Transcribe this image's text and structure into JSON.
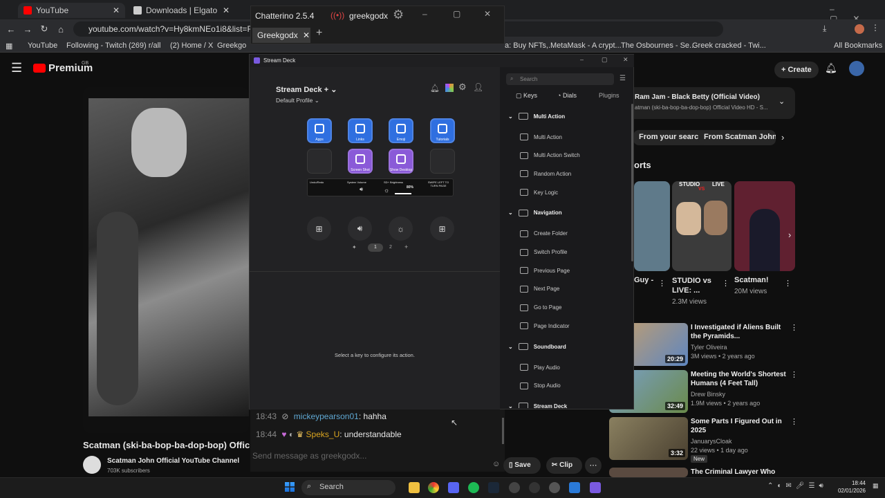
{
  "browser": {
    "tabs": [
      {
        "label": "YouTube",
        "color": "#ff0000"
      },
      {
        "label": "Downloads | Elgato",
        "color": "#cccccc"
      }
    ],
    "url": "youtube.com/watch?v=Hy8kmNEo1i8&list=RDHy8kmNE",
    "bookmarks": [
      "YouTube",
      "Following - Twitch",
      "(269) r/all",
      "(2) Home / X",
      "Greekgo",
      "a: Buy NFTs,...",
      "MetaMask - A crypt...",
      "The Osbournes - Se...",
      "Greek cracked - Twi...",
      "All Bookmarks"
    ]
  },
  "youtube": {
    "logo": "Premium",
    "logo_sup": "GB",
    "create_label": "Create",
    "playlist_title": "Ram Jam - Black Betty (Official Video)",
    "playlist_sub": "atman (ski-ba-bop-ba-dop-bop) Official Video HD - S...",
    "chips": [
      "From your search",
      "From Scatman John Of"
    ],
    "shorts_heading": "orts",
    "shorts": [
      {
        "title": "Guy -",
        "views": ""
      },
      {
        "title": "STUDIO vs LIVE: ...",
        "views": "2.3M views"
      },
      {
        "title": "Scatman!",
        "views": "20M views"
      }
    ],
    "short_thumb_labels": [
      "STUDIO",
      "VS",
      "LIVE"
    ],
    "videos": [
      {
        "title": "I Investigated if Aliens Built the Pyramids...",
        "channel": "Tyler Oliveira",
        "meta": "3M views • 2 years ago",
        "duration": "20:29"
      },
      {
        "title": "Meeting the World's Shortest Humans (4 Feet Tall)",
        "channel": "Drew Binsky",
        "meta": "1.9M views • 2 years ago",
        "duration": "32:49"
      },
      {
        "title": "Some Parts I Figured Out in 2025",
        "channel": "JanuarysCloak",
        "meta": "22 views • 1 day ago",
        "duration": "3:32",
        "badge": "New"
      },
      {
        "title": "The Criminal Lawyer Who Frees",
        "channel": "",
        "meta": "",
        "duration": ""
      }
    ],
    "video_title": "Scatman (ski-ba-bop-ba-dop-bop) Offici",
    "channel_name": "Scatman John Official YouTube Channel",
    "subscribers": "703K subscribers",
    "save_label": "Save",
    "clip_label": "Clip"
  },
  "chatterino": {
    "title": "Chatterino 2.5.4",
    "user": "greekgodx",
    "tab": "Greekgodx",
    "messages": [
      {
        "time": "18:43",
        "user": "mickeypearson01",
        "text": "hahha",
        "color": "#5fa8d3"
      },
      {
        "time": "18:44",
        "user": "Speks_U",
        "text": "understandable",
        "color": "#daa520"
      }
    ],
    "input_placeholder": "Send message as greekgodx..."
  },
  "streamdeck": {
    "window_title": "Stream Deck",
    "device": "Stream Deck +",
    "profile": "Default Profile",
    "keys": [
      {
        "label": "Apps",
        "color": "#2f6fe0"
      },
      {
        "label": "Links",
        "color": "#2f6fe0"
      },
      {
        "label": "Emoji",
        "color": "#2f6fe0"
      },
      {
        "label": "Tutorials",
        "color": "#2f6fe0"
      },
      {
        "label": "",
        "color": "#2a2a2c"
      },
      {
        "label": "Screen Shot",
        "color": "#8a5ad8"
      },
      {
        "label": "Show Desktop",
        "color": "#8a5ad8"
      },
      {
        "label": "",
        "color": "#2a2a2c"
      }
    ],
    "touch_strip": [
      "Undo/Redo",
      "System Volume",
      "SD+ Brightness",
      "SWIPE LEFT TO TURN PAGE"
    ],
    "brightness": "80%",
    "pages": [
      "1",
      "2",
      "+"
    ],
    "hint": "Select a key to configure its action.",
    "search_placeholder": "Search",
    "tabs": [
      "Keys",
      "Dials",
      "Plugins"
    ],
    "groups": [
      {
        "name": "Multi Action",
        "actions": [
          "Multi Action",
          "Multi Action Switch",
          "Random Action",
          "Key Logic"
        ]
      },
      {
        "name": "Navigation",
        "actions": [
          "Create Folder",
          "Switch Profile",
          "Previous Page",
          "Next Page",
          "Go to Page",
          "Page Indicator"
        ]
      },
      {
        "name": "Soundboard",
        "actions": [
          "Play Audio",
          "Stop Audio"
        ]
      },
      {
        "name": "Stream Deck",
        "actions": []
      }
    ]
  },
  "taskbar": {
    "search": "Search",
    "time": "18:44",
    "date": "02/01/2026"
  }
}
